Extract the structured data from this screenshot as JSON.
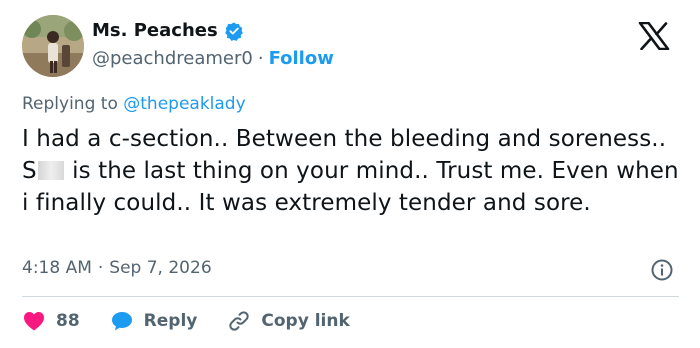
{
  "user": {
    "name": "Ms. Peaches",
    "handle": "@peachdreamer0",
    "separator": "·",
    "follow_label": "Follow",
    "verified": true
  },
  "reply": {
    "prefix": "Replying to ",
    "mention": "@thepeaklady"
  },
  "tweet": {
    "text_before": "I had a c-section.. Between the bleeding and soreness.. S",
    "text_after": " is the last thing on your mind.. Trust me. Even when i finally could.. It was extremely tender and sore."
  },
  "meta": {
    "time": "4:18 AM",
    "separator": "·",
    "date": "Sep 7, 2026"
  },
  "actions": {
    "like_count": "88",
    "reply_label": "Reply",
    "copy_label": "Copy link"
  },
  "colors": {
    "accent": "#1d9bf0",
    "like": "#f91880",
    "muted": "#536471",
    "text": "#0f1419"
  },
  "icons": {
    "logo": "x-logo-icon",
    "verified": "verified-badge-icon",
    "info": "info-icon",
    "like": "heart-icon",
    "reply": "reply-bubble-icon",
    "copy": "link-icon"
  }
}
